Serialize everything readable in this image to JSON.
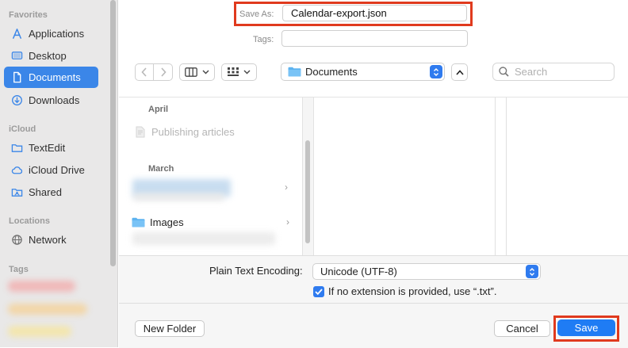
{
  "sidebar": {
    "favorites_title": "Favorites",
    "favorites": [
      {
        "label": "Applications",
        "icon": "applications-icon"
      },
      {
        "label": "Desktop",
        "icon": "desktop-icon"
      },
      {
        "label": "Documents",
        "icon": "document-icon",
        "active": true
      },
      {
        "label": "Downloads",
        "icon": "downloads-icon"
      }
    ],
    "icloud_title": "iCloud",
    "icloud": [
      {
        "label": "TextEdit",
        "icon": "folder-icon"
      },
      {
        "label": "iCloud Drive",
        "icon": "cloud-icon"
      },
      {
        "label": "Shared",
        "icon": "shared-folder-icon"
      }
    ],
    "locations_title": "Locations",
    "locations": [
      {
        "label": "Network",
        "icon": "network-icon"
      }
    ],
    "tags_title": "Tags"
  },
  "header": {
    "save_as_label": "Save As:",
    "save_as_value": "Calendar-export.json",
    "tags_label": "Tags:",
    "tags_value": ""
  },
  "toolbar": {
    "location": "Documents",
    "search_placeholder": "Search"
  },
  "browser": {
    "groups": [
      {
        "label": "April",
        "items": [
          {
            "name": "Publishing articles",
            "dimmed": true
          }
        ]
      },
      {
        "label": "March",
        "items": [
          {
            "name": "Images",
            "icon": "folder-icon"
          }
        ]
      }
    ]
  },
  "options": {
    "encoding_label": "Plain Text Encoding:",
    "encoding_value": "Unicode (UTF-8)",
    "checkbox_label": "If no extension is provided, use “.txt”.",
    "checkbox_checked": true
  },
  "buttons": {
    "new_folder": "New Folder",
    "cancel": "Cancel",
    "save": "Save"
  },
  "colors": {
    "accent": "#1f7cf4",
    "highlight_box": "#e03a1e",
    "sidebar_active": "#3b86e8"
  }
}
